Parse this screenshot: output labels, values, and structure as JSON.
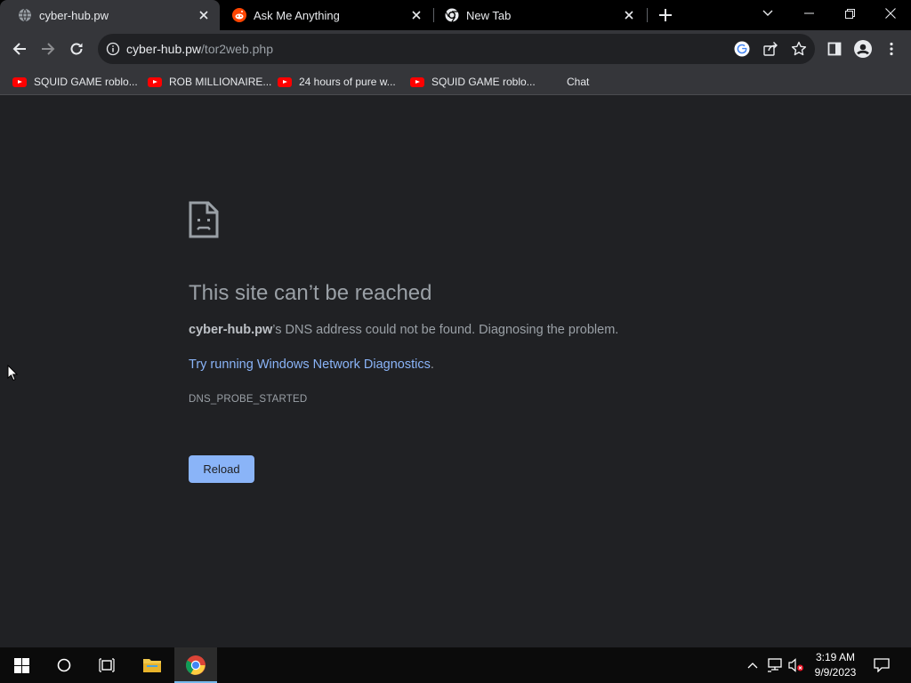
{
  "tabs": [
    {
      "title": "cyber-hub.pw",
      "favicon": "globe-icon",
      "active": true
    },
    {
      "title": "Ask Me Anything",
      "favicon": "reddit-icon",
      "active": false
    },
    {
      "title": "New Tab",
      "favicon": "chrome-icon",
      "active": false
    }
  ],
  "window_controls": [
    "tab-search-icon",
    "minimize-icon",
    "restore-icon",
    "close-icon"
  ],
  "omnibox": {
    "host": "cyber-hub.pw",
    "path": "/tor2web.php"
  },
  "bookmarks": [
    {
      "label": "SQUID GAME roblo...",
      "icon": "youtube-icon"
    },
    {
      "label": "ROB MILLIONAIRE...",
      "icon": "youtube-icon"
    },
    {
      "label": "24 hours of pure w...",
      "icon": "youtube-icon"
    },
    {
      "label": "SQUID GAME roblo...",
      "icon": "youtube-icon"
    },
    {
      "label": "Chat",
      "icon": ""
    }
  ],
  "error": {
    "title": "This site can’t be reached",
    "host_bold": "cyber-hub.pw",
    "description_rest": "’s DNS address could not be found. Diagnosing the problem.",
    "link_text": "Try running Windows Network Diagnostics",
    "link_suffix": ".",
    "code": "DNS_PROBE_STARTED",
    "reload_label": "Reload"
  },
  "taskbar": {
    "time": "3:19 AM",
    "date": "9/9/2023",
    "apps": [
      "windows-start-icon",
      "cortana-search-icon",
      "task-view-icon",
      "file-explorer-icon",
      "chrome-icon"
    ]
  },
  "colors": {
    "background": "#202124",
    "toolbar": "#35363a",
    "link": "#8ab4f8",
    "button": "#8ab4f8"
  }
}
